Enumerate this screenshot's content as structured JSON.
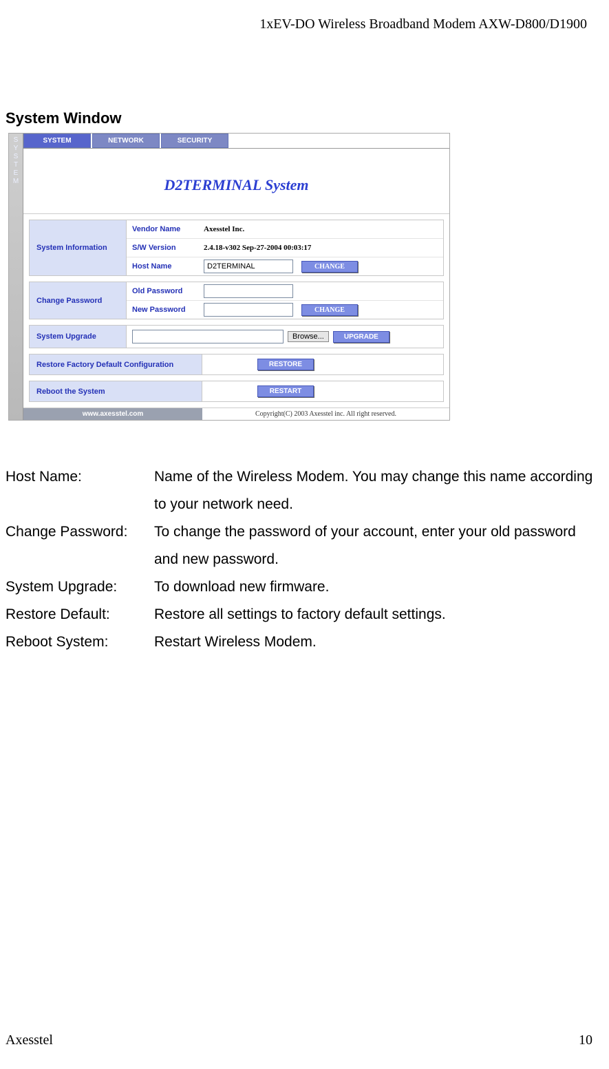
{
  "header": "1xEV-DO Wireless Broadband Modem AXW-D800/D1900",
  "section_title": "System Window",
  "screenshot": {
    "vtab": "SYSTEM",
    "tabs": [
      {
        "label": "SYSTEM",
        "active": true
      },
      {
        "label": "NETWORK",
        "active": false
      },
      {
        "label": "SECURITY",
        "active": false
      }
    ],
    "banner_title": "D2TERMINAL System",
    "sys_info": {
      "panel_label": "System Information",
      "vendor_label": "Vendor Name",
      "vendor_value": "Axesstel Inc.",
      "sw_label": "S/W Version",
      "sw_value": "2.4.18-v302 Sep-27-2004 00:03:17",
      "host_label": "Host Name",
      "host_value": "D2TERMINAL",
      "change_btn": "CHANGE"
    },
    "change_pw": {
      "panel_label": "Change Password",
      "old_label": "Old Password",
      "new_label": "New Password",
      "change_btn": "CHANGE"
    },
    "upgrade": {
      "panel_label": "System Upgrade",
      "browse_btn": "Browse...",
      "upgrade_btn": "UPGRADE"
    },
    "restore": {
      "panel_label": "Restore Factory Default Configuration",
      "restore_btn": "RESTORE"
    },
    "reboot": {
      "panel_label": "Reboot the System",
      "restart_btn": "RESTART"
    },
    "footer_left": "www.axesstel.com",
    "footer_right": "Copyright(C) 2003 Axesstel inc. All right reserved."
  },
  "descriptions": [
    {
      "label": "Host Name:",
      "text": "Name of the Wireless Modem. You may change this name according to your network need."
    },
    {
      "label": "Change Password:",
      "text": "To change the password of your account, enter your old password and new password."
    },
    {
      "label": "System Upgrade:",
      "text": "To download new firmware."
    },
    {
      "label": "Restore Default:",
      "text": "Restore all settings to factory default settings."
    },
    {
      "label": "Reboot System:",
      "text": "Restart Wireless Modem."
    }
  ],
  "footer_left": "Axesstel",
  "footer_right": "10"
}
